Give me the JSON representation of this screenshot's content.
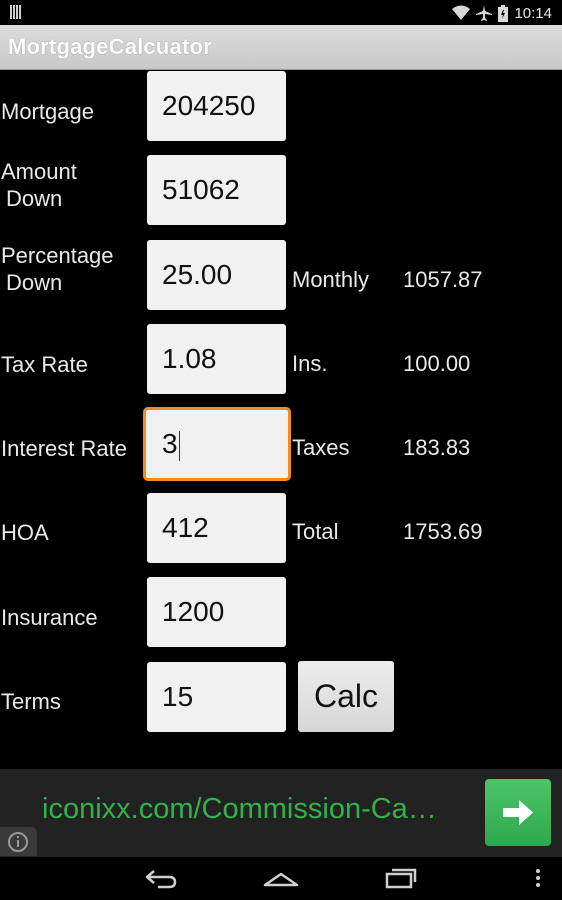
{
  "status_bar": {
    "time": "10:14",
    "icons": [
      "signal-icon",
      "wifi-icon",
      "airplane-icon",
      "battery-icon"
    ]
  },
  "app": {
    "title": "MortgageCalcuator"
  },
  "form": {
    "mortgage": {
      "label": "Mortgage",
      "value": "204250"
    },
    "amount_down": {
      "label_line1": "Amount",
      "label_line2": "Down",
      "value": "51062"
    },
    "percentage_down": {
      "label_line1": "Percentage",
      "label_line2": "Down",
      "value": "25.00"
    },
    "tax_rate": {
      "label": "Tax Rate",
      "value": "1.08"
    },
    "interest_rate": {
      "label": "Interest Rate",
      "value": "3"
    },
    "hoa": {
      "label": "HOA",
      "value": "412"
    },
    "insurance": {
      "label": "Insurance",
      "value": "1200"
    },
    "terms": {
      "label": "Terms",
      "value": "15"
    },
    "calc_label": "Calc"
  },
  "results": {
    "monthly": {
      "label": "Monthly",
      "value": "1057.87"
    },
    "ins": {
      "label": "Ins.",
      "value": "100.00"
    },
    "taxes": {
      "label": "Taxes",
      "value": "183.83"
    },
    "total": {
      "label": "Total",
      "value": "1753.69"
    }
  },
  "ad": {
    "text": "iconixx.com/Commission-Ca…"
  },
  "colors": {
    "focus": "#f28c1c",
    "ad_text": "#31b24b",
    "ad_button": "#3bb85a"
  }
}
